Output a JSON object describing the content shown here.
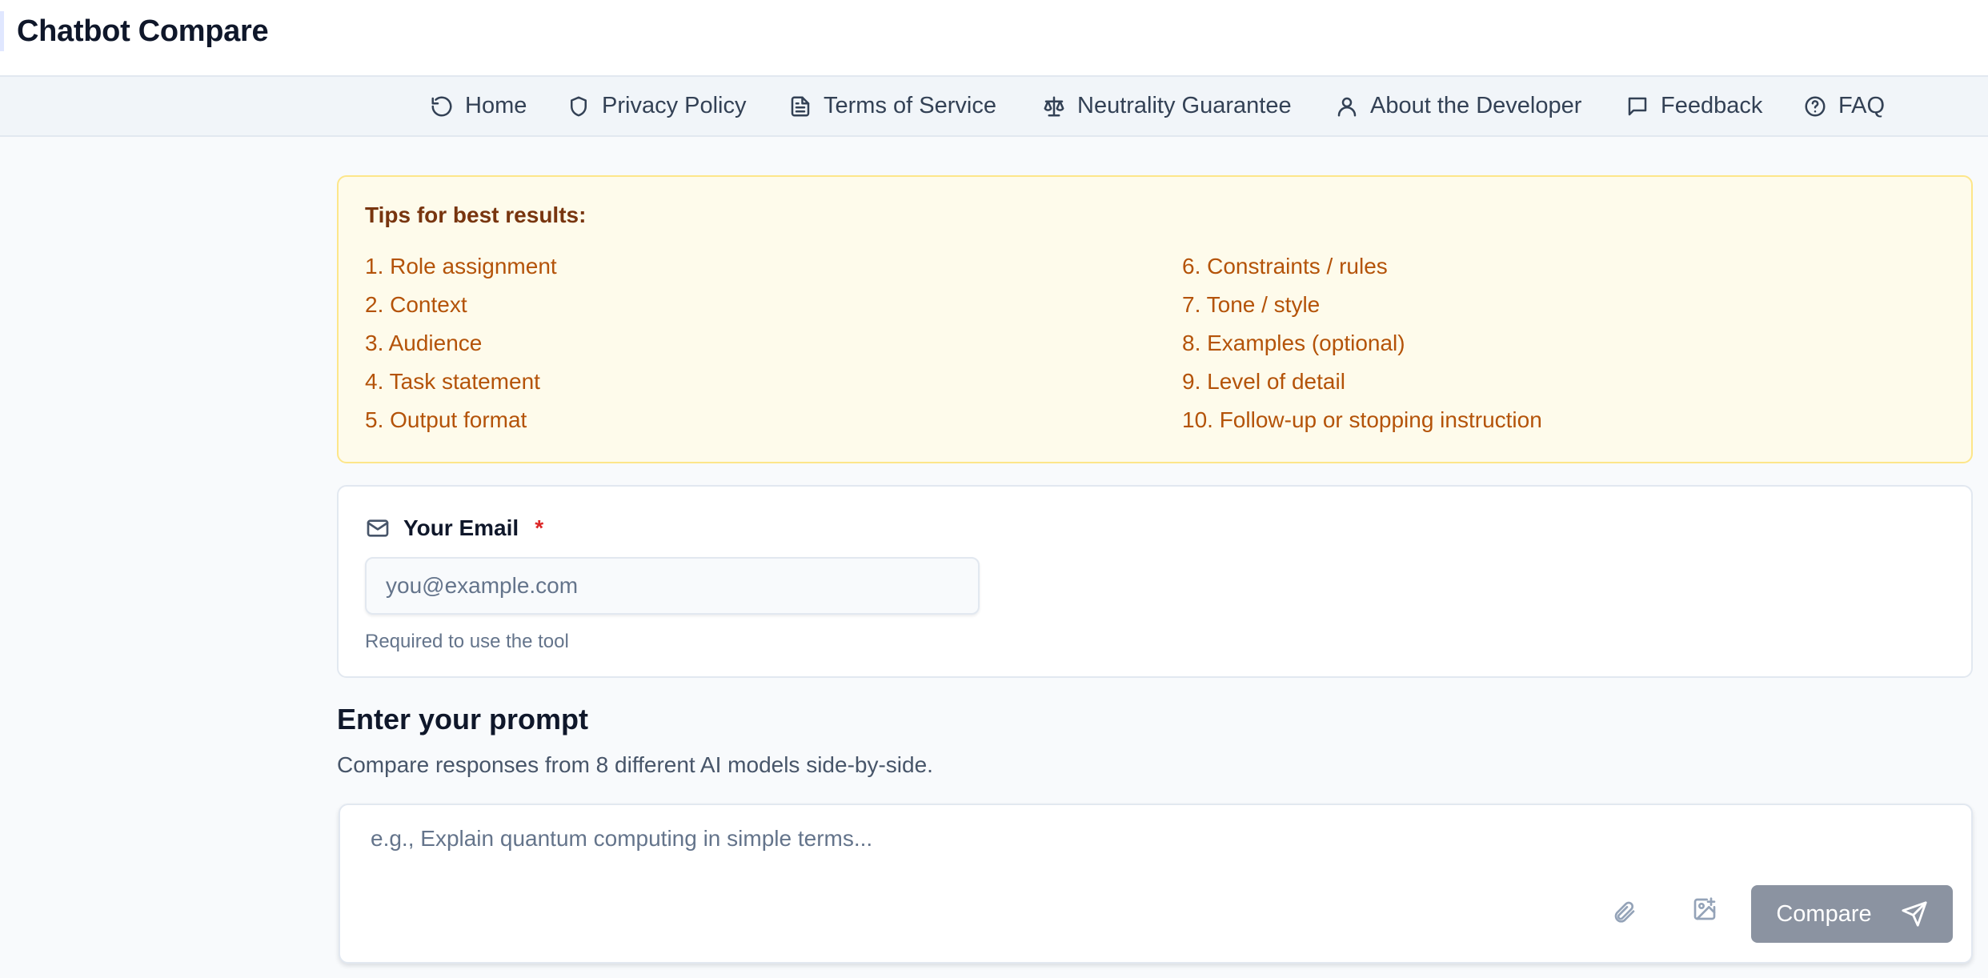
{
  "header": {
    "brand": "Chatbot Compare"
  },
  "nav": {
    "items": [
      {
        "label": "Home",
        "icon": "refresh-icon"
      },
      {
        "label": "Privacy Policy",
        "icon": "shield-icon"
      },
      {
        "label": "Terms of Service",
        "icon": "document-icon"
      },
      {
        "label": "Neutrality Guarantee",
        "icon": "scale-icon"
      },
      {
        "label": "About the Developer",
        "icon": "user-icon"
      },
      {
        "label": "Feedback",
        "icon": "message-icon"
      },
      {
        "label": "FAQ",
        "icon": "help-circle-icon"
      }
    ]
  },
  "tips": {
    "title": "Tips for best results:",
    "left": [
      "1. Role assignment",
      "2. Context",
      "3. Audience",
      "4. Task statement",
      "5. Output format"
    ],
    "right": [
      "6. Constraints / rules",
      "7. Tone / style",
      "8. Examples (optional)",
      "9. Level of detail",
      "10. Follow-up or stopping instruction"
    ]
  },
  "email": {
    "label": "Your Email",
    "required_mark": "*",
    "value": "",
    "placeholder": "you@example.com",
    "help": "Required to use the tool"
  },
  "prompt": {
    "title": "Enter your prompt",
    "subtitle": "Compare responses from 8 different AI models side-by-side.",
    "placeholder": "e.g., Explain quantum computing in simple terms...",
    "value": "",
    "compare_label": "Compare"
  },
  "colors": {
    "accent_button": "#8b93a1",
    "tips_background": "#fefbeb",
    "tips_text": "#b45309",
    "required": "#dc2626"
  }
}
